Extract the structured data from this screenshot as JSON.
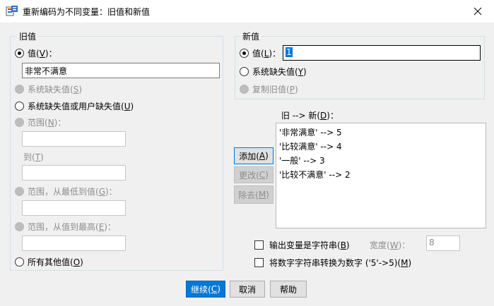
{
  "window": {
    "title": "重新编码为不同变量：旧值和新值",
    "colors": {
      "accent": "#0078d7",
      "titlebar": "#ffffff",
      "dialog": "#f0f0f0"
    }
  },
  "old_value": {
    "group_label": "旧值",
    "value_radio": {
      "text": "值(",
      "key": "V",
      "suffix": ")："
    },
    "value_input": "非常不满意",
    "system_missing": {
      "text": "系统缺失值(",
      "key": "S",
      "suffix": ")"
    },
    "sys_or_user_missing": {
      "text": "系统缺失值或用户缺失值(",
      "key": "U",
      "suffix": ")"
    },
    "range": {
      "text": "范围(",
      "key": "N",
      "suffix": ")："
    },
    "range_to": {
      "text": "到(",
      "key": "T",
      "suffix": ")"
    },
    "range_lowest": {
      "text": "范围，从最低到值(",
      "key": "G",
      "suffix": ")："
    },
    "range_highest": {
      "text": "范围，从值到最高(",
      "key": "E",
      "suffix": ")："
    },
    "all_other": {
      "text": "所有其他值(",
      "key": "O",
      "suffix": ")"
    }
  },
  "new_value": {
    "group_label": "新值",
    "value_radio": {
      "text": "值(",
      "key": "L",
      "suffix": ")："
    },
    "value_input": "1",
    "system_missing": {
      "text": "系统缺失值(",
      "key": "Y",
      "suffix": ")"
    },
    "copy_old": {
      "text": "复制旧值(",
      "key": "P",
      "suffix": ")"
    }
  },
  "mapping": {
    "label": {
      "text": "旧 --> 新(",
      "key": "D",
      "suffix": ")："
    },
    "items": [
      "'非常满意' --> 5",
      "'比较满意' --> 4",
      "'一般' --> 3",
      "'比较不满意' --> 2"
    ],
    "add_button": {
      "text": "添加(",
      "key": "A",
      "suffix": ")"
    },
    "change_button": {
      "text": "更改(",
      "key": "C",
      "suffix": ")"
    },
    "remove_button": {
      "text": "除去(",
      "key": "M",
      "suffix": ")"
    }
  },
  "options": {
    "output_string": {
      "text": "输出变量是字符串(",
      "key": "B",
      "suffix": ")"
    },
    "width_label": {
      "text": "宽度(",
      "key": "W",
      "suffix": ")："
    },
    "width_value": "8",
    "convert_numeric": {
      "text": "将数字字符串转换为数字 ('5'->5)(",
      "key": "M",
      "suffix": ")"
    }
  },
  "footer": {
    "continue_button": {
      "text": "继续(",
      "key": "C",
      "suffix": ")"
    },
    "cancel_button": "取消",
    "help_button": "帮助"
  }
}
